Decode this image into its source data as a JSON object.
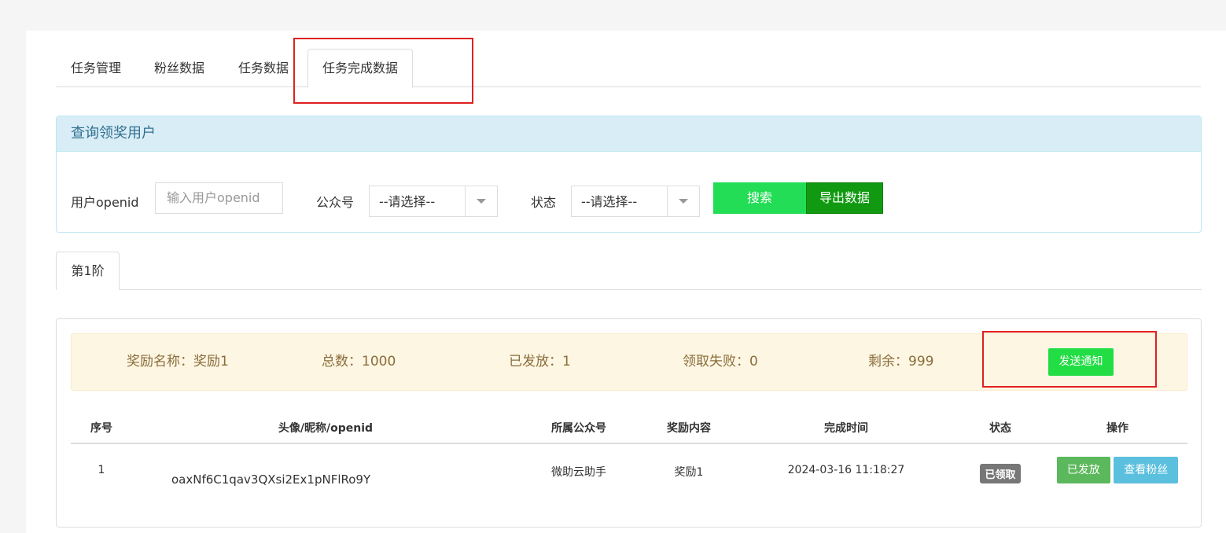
{
  "tabs": [
    {
      "label": "任务管理"
    },
    {
      "label": "粉丝数据"
    },
    {
      "label": "任务数据"
    },
    {
      "label": "任务完成数据",
      "active": true
    }
  ],
  "query_panel": {
    "title": "查询领奖用户",
    "openid_label": "用户openid",
    "openid_placeholder": "输入用户openid",
    "account_label": "公众号",
    "account_value": "--请选择--",
    "status_label": "状态",
    "status_value": "--请选择--",
    "search_label": "搜索",
    "export_label": "导出数据"
  },
  "stage_tab": {
    "label": "第1阶"
  },
  "reward_summary": {
    "name": "奖励名称：奖励1",
    "total": "总数：1000",
    "issued": "已发放：1",
    "failed": "领取失败：0",
    "remaining": "剩余：999",
    "notify_label": "发送通知"
  },
  "table": {
    "headers": [
      "序号",
      "头像/昵称/openid",
      "所属公众号",
      "奖励内容",
      "完成时间",
      "状态",
      "操作"
    ],
    "rows": [
      {
        "index": "1",
        "openid": "oaxNf6C1qav3QXsi2Ex1pNFlRo9Y",
        "account": "微助云助手",
        "reward": "奖励1",
        "time": "2024-03-16 11:18:27",
        "status": "已领取",
        "op_issued": "已发放",
        "op_view": "查看粉丝"
      }
    ]
  },
  "colors": {
    "highlight": "#e02020",
    "search_button": "#22dd55",
    "export_button": "#119a11",
    "panel_header_bg": "#d9edf7",
    "alert_bg": "#fdf6e3"
  }
}
